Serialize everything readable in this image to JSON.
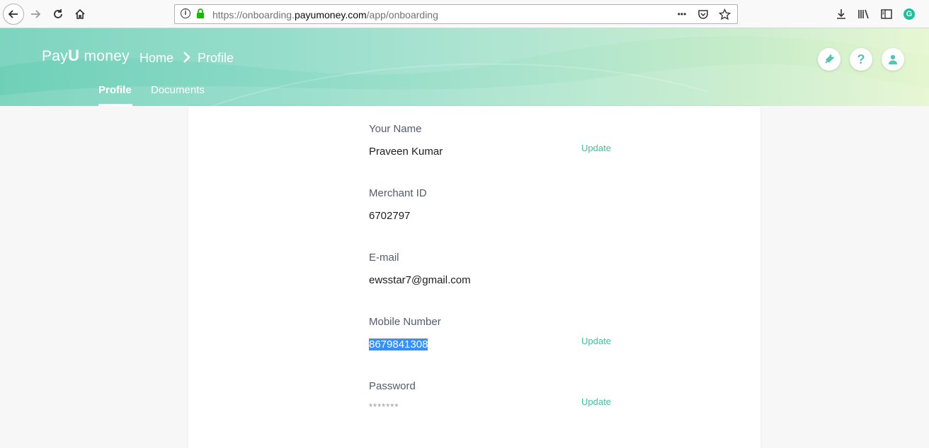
{
  "browser": {
    "url_prefix": "https://onboarding.",
    "url_domain": "payumoney.com",
    "url_path": "/app/onboarding",
    "menu_dots": "•••"
  },
  "header": {
    "logo_pay": "Pay",
    "logo_u": "U",
    "logo_money": "money",
    "breadcrumb_home": "Home",
    "breadcrumb_profile": "Profile",
    "tabs": [
      {
        "label": "Profile",
        "active": true
      },
      {
        "label": "Documents",
        "active": false
      }
    ],
    "help_label": "?",
    "accent_color": "#57c5ad"
  },
  "profile": {
    "name_label": "Your Name",
    "name_value": "Praveen Kumar",
    "merchant_label": "Merchant ID",
    "merchant_value": "6702797",
    "email_label": "E-mail",
    "email_value": "ewsstar7@gmail.com",
    "mobile_label": "Mobile Number",
    "mobile_value": "8679841308",
    "password_label": "Password",
    "password_value": "*******",
    "update_label": "Update",
    "update_color": "#3cc3a2"
  }
}
